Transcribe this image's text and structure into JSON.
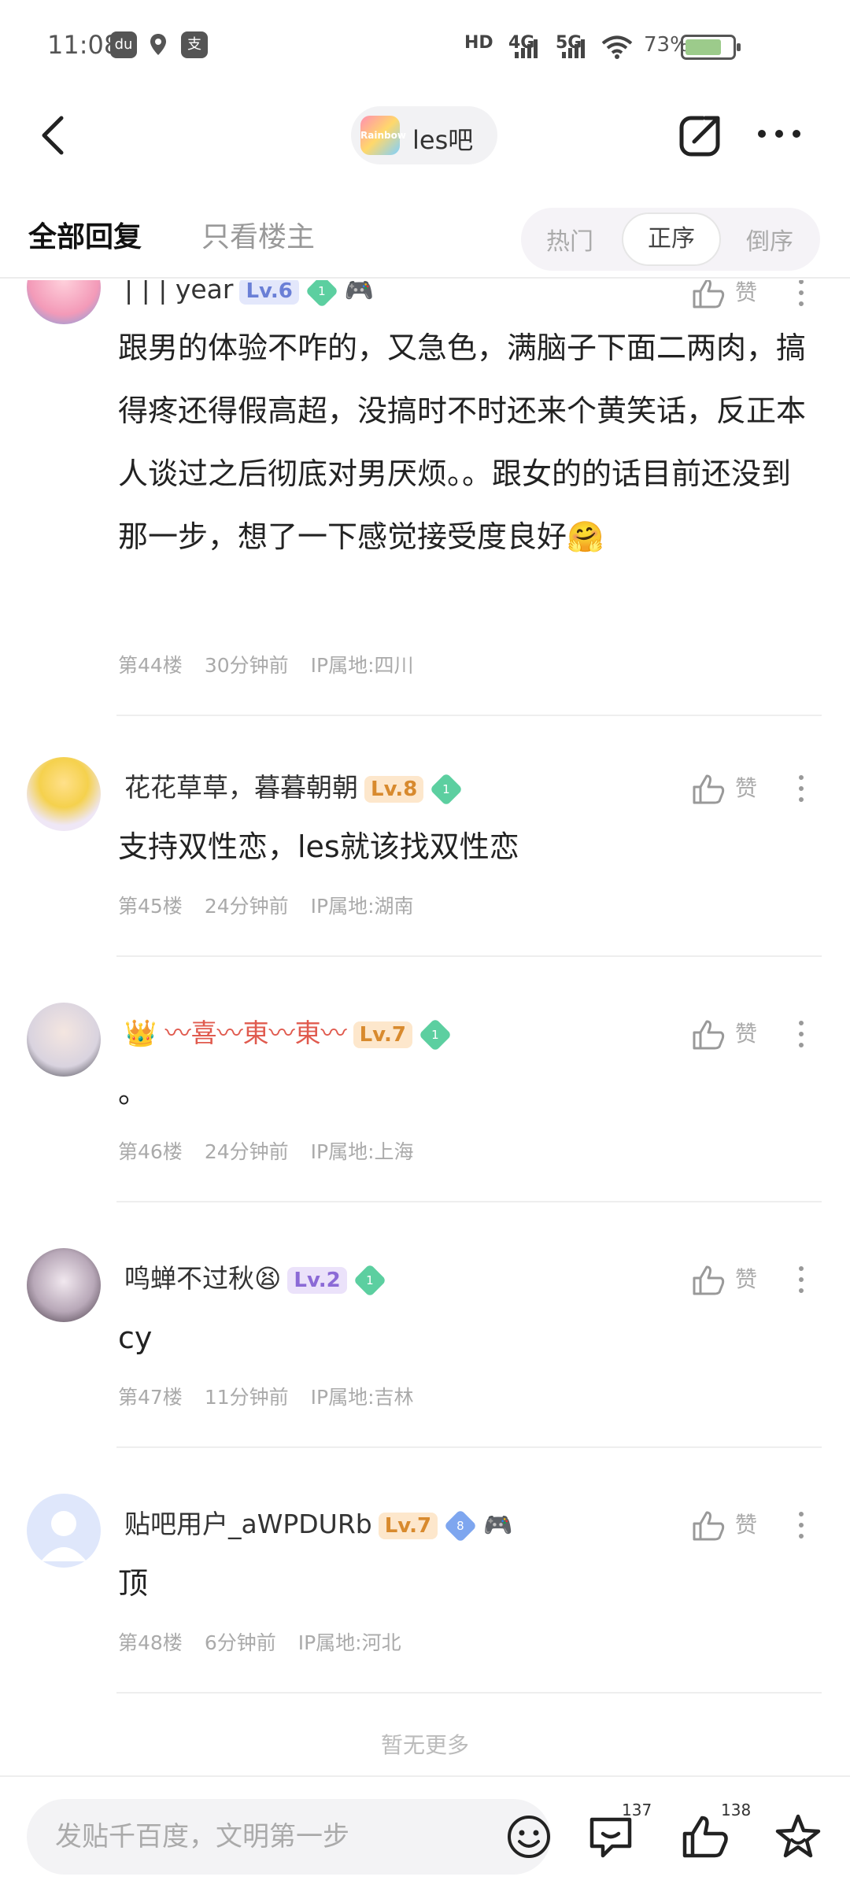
{
  "status": {
    "time": "11:08",
    "network": [
      "HD",
      "4G",
      "5G"
    ],
    "battery": "73%",
    "icons": [
      "du-app-icon",
      "map-pin-icon",
      "alipay-icon"
    ]
  },
  "header": {
    "forum_name": "les吧",
    "forum_logo_text": "Rainbow"
  },
  "tabs": {
    "all": "全部回复",
    "owner_only": "只看楼主",
    "sort": [
      "热门",
      "正序",
      "倒序"
    ],
    "sort_active": "正序"
  },
  "posts": [
    {
      "username": "| | | year",
      "level": "Lv.6",
      "level_color": "#6a7fd6",
      "gem": "1",
      "badge": "🎮",
      "content": "跟男的体验不咋的，又急色，满脑子下面二两肉，搞得疼还得假高超，没搞时不时还来个黄笑话，反正本人谈过之后彻底对男厌烦。。跟女的的话目前还没到那一步，想了一下感觉接受度良好🤗",
      "floor": "第44楼",
      "time": "30分钟前",
      "ip": "IP属地:四川",
      "like_label": "赞"
    },
    {
      "username": "花花草草，暮暮朝朝",
      "level": "Lv.8",
      "gem": "1",
      "content": "支持双性恋，les就该找双性恋",
      "floor": "第45楼",
      "time": "24分钟前",
      "ip": "IP属地:湖南",
      "like_label": "赞"
    },
    {
      "username_prefix": "👑",
      "username": "〰喜〰東〰東〰",
      "level": "Lv.7",
      "gem": "1",
      "content": "。",
      "floor": "第46楼",
      "time": "24分钟前",
      "ip": "IP属地:上海",
      "like_label": "赞"
    },
    {
      "username": "鸣蝉不过秋😫",
      "level": "Lv.2",
      "gem": "1",
      "content": "cy",
      "floor": "第47楼",
      "time": "11分钟前",
      "ip": "IP属地:吉林",
      "like_label": "赞"
    },
    {
      "username": "贴吧用户_aWPDURb",
      "level": "Lv.7",
      "gem": "8",
      "badge": "🎮",
      "content": "顶",
      "floor": "第48楼",
      "time": "6分钟前",
      "ip": "IP属地:河北",
      "like_label": "赞"
    }
  ],
  "no_more": "暂无更多",
  "bottom": {
    "input_placeholder": "发贴千百度，文明第一步",
    "comment_count": "137",
    "like_count": "138"
  },
  "colors": {
    "accent_red": "#e05a4e",
    "level_blue": "#6a7fd6",
    "level_orange": "#d88a2e",
    "level_purple": "#8b6ad6",
    "gem_green": "#5ccfa0"
  }
}
